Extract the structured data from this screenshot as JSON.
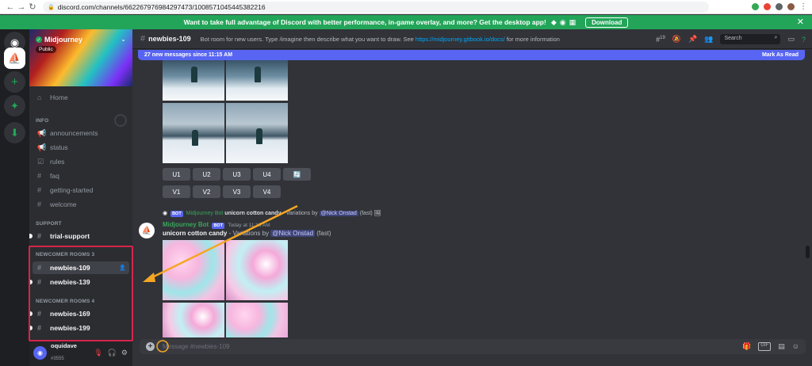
{
  "browser": {
    "url": "discord.com/channels/662267976984297473/1008571045445382216"
  },
  "banner": {
    "text": "Want to take full advantage of Discord with better performance, in-game overlay, and more? Get the desktop app!",
    "download_label": "Download"
  },
  "server": {
    "name": "Midjourney",
    "badge": "Public"
  },
  "channels": {
    "home": "Home",
    "info_header": "INFO",
    "info": [
      "announcements",
      "status",
      "rules",
      "faq",
      "getting-started",
      "welcome"
    ],
    "support_header": "SUPPORT",
    "support": [
      "trial-support"
    ],
    "rooms3_header": "NEWCOMER ROOMS 3",
    "rooms3": [
      "newbies-109",
      "newbies-139"
    ],
    "rooms4_header": "NEWCOMER ROOMS 4",
    "rooms4": [
      "newbies-169",
      "newbies-199"
    ]
  },
  "user": {
    "name": "oquidave",
    "tag": "#3555"
  },
  "topbar": {
    "channel": "newbies-109",
    "topic": "Bot room for new users. Type /imagine then describe what you want to draw. See ",
    "link": "https://midjourney.gitbook.io/docs/",
    "topic_end": " for more information",
    "thread_count": "19",
    "search_placeholder": "Search"
  },
  "newbar": {
    "text": "27 new messages since 11:15 AM",
    "mark_read": "Mark As Read"
  },
  "buttons": {
    "upscale": [
      "U1",
      "U2",
      "U3",
      "U4"
    ],
    "variation": [
      "V1",
      "V2",
      "V3",
      "V4"
    ]
  },
  "message": {
    "reply_author": "Midjourney Bot",
    "reply_prompt": "unicorn cotton candy",
    "reply_suffix": " - Variations by ",
    "reply_mention": "@Nick Onstad",
    "reply_speed": "(fast)",
    "author": "Midjourney Bot",
    "bot_badge": "BOT",
    "timestamp": "Today at 11:16 AM",
    "prompt": "unicorn cotton candy",
    "suffix": " - Variations by ",
    "mention": "@Nick Onstad",
    "speed": "(fast)"
  },
  "composer": {
    "placeholder": "Message #newbies-109",
    "gif_label": "GIF"
  },
  "colors": {
    "accent": "#5865f2",
    "banner": "#23a559",
    "highlight_box": "#d6254b",
    "annotation_arrow": "#f5a623"
  }
}
